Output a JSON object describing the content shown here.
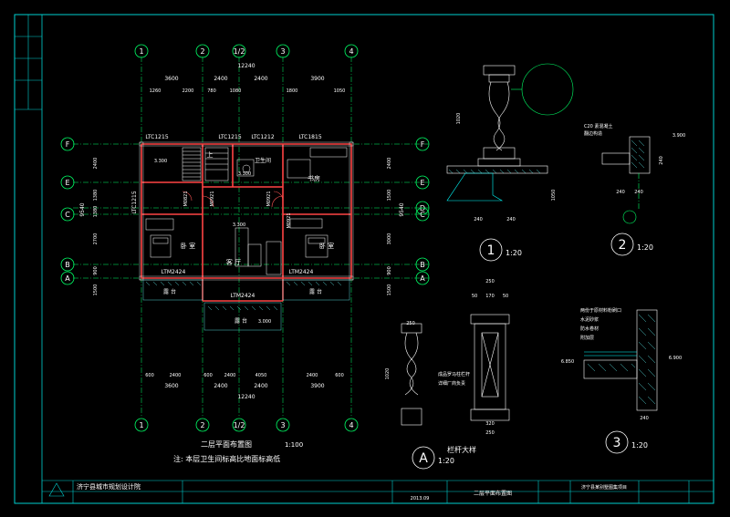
{
  "colors": {
    "background": "#000000",
    "frame": "#00e0e0",
    "wall": "#ff4040",
    "axis": "#00ff66",
    "dimension": "#ffffff",
    "label": "#ffff66",
    "detail": "#00ffff"
  },
  "grid": {
    "columns": [
      "1",
      "2",
      "1/2",
      "3",
      "4"
    ],
    "rows": [
      "F",
      "E",
      "D",
      "C",
      "B",
      "A"
    ],
    "left_rows": [
      "F",
      "E",
      "C",
      "B",
      "A"
    ]
  },
  "dims": {
    "top_total": "12240",
    "bottom_total": "12240",
    "top_segments": [
      "3600",
      "2400",
      "2400",
      "3900"
    ],
    "top_sub": [
      "1260",
      "2200",
      "780",
      "1080",
      "1800",
      "1050"
    ],
    "bottom_segments": [
      "3600",
      "2400",
      "2400",
      "3900"
    ],
    "bottom_sub": [
      "600",
      "2400",
      "600",
      "2400",
      "4050",
      "2400",
      "600"
    ],
    "bottom_sub2": [
      "3600",
      "2400",
      "2400",
      "3900"
    ],
    "left_total": "9540",
    "left_segments": [
      "2400",
      "1380",
      "1380",
      "2700",
      "900",
      "1500"
    ],
    "right_total": "9540",
    "right_segments": [
      "2400",
      "1500",
      "3000",
      "900",
      "1500"
    ]
  },
  "windows": [
    "LTC1215",
    "LTC1215",
    "LTC1212",
    "LTC1815",
    "LTC1215"
  ],
  "doors": [
    "LTM2424",
    "LTM2424",
    "LTM2424"
  ],
  "door_tags": [
    "M0821",
    "M0921",
    "M0921",
    "M0921"
  ],
  "rooms": {
    "bedroom1": "卧 室",
    "bedroom2": "卧 室",
    "living": "客 厅",
    "study": "书房",
    "stair": "上",
    "wc": "卫生间",
    "balcony1": "露 台",
    "balcony2": "露 台",
    "balcony3": "露 台"
  },
  "levels": [
    "3.300",
    "3.300",
    "3.300",
    "3.000"
  ],
  "plan": {
    "title": "二层平面布置图",
    "scale": "1:100",
    "note": "注: 本层卫生间标高比地面标高低"
  },
  "details": [
    {
      "num": "1",
      "scale": "1:20"
    },
    {
      "num": "2",
      "scale": "1:20"
    },
    {
      "num": "3",
      "scale": "1:20"
    },
    {
      "num": "A",
      "scale": "1:20",
      "title": "栏杆大样"
    }
  ],
  "detail_notes": {
    "d2": [
      "C20 素混凝土",
      "翻边构造"
    ],
    "d3": [
      "两份于原材料粉刷口",
      "水泥砂浆",
      "防水卷材",
      "附加层"
    ],
    "dA": [
      "成品罗马柱栏杆",
      "详细厂商负责"
    ]
  },
  "detail_dims": {
    "d1": [
      "1020",
      "240",
      "240",
      "1050"
    ],
    "d2": [
      "3.900",
      "240",
      "240",
      "240"
    ],
    "d3": [
      "6.850",
      "6.900",
      "240"
    ],
    "dA": [
      "250",
      "50",
      "170",
      "50",
      "1020",
      "250",
      "320",
      "250"
    ]
  },
  "title_block": {
    "company": "济宁县城市规划设计院",
    "drawing": "二层平面布置图",
    "date": "2013.09",
    "project": "济宁县某别墅图集项目"
  }
}
